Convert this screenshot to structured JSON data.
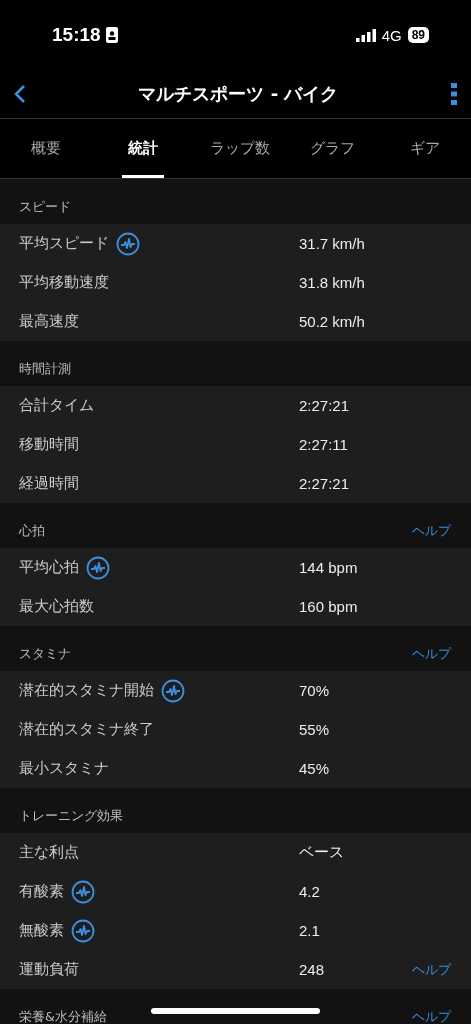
{
  "status_bar": {
    "time": "15:18",
    "network": "4G",
    "battery": "89"
  },
  "nav": {
    "title": "マルチスポーツ - バイク"
  },
  "tabs": [
    {
      "label": "概要",
      "selected": false
    },
    {
      "label": "統計",
      "selected": true
    },
    {
      "label": "ラップ数",
      "selected": false
    },
    {
      "label": "グラフ",
      "selected": false
    },
    {
      "label": "ギア",
      "selected": false
    }
  ],
  "sections": [
    {
      "title": "スピード",
      "rows": [
        {
          "label": "平均スピード",
          "chart": true,
          "value": "31.7 km/h"
        },
        {
          "label": "平均移動速度",
          "chart": false,
          "value": "31.8 km/h"
        },
        {
          "label": "最高速度",
          "chart": false,
          "value": "50.2 km/h"
        }
      ]
    },
    {
      "title": "時間計測",
      "rows": [
        {
          "label": "合計タイム",
          "chart": false,
          "value": "2:27:21"
        },
        {
          "label": "移動時間",
          "chart": false,
          "value": "2:27:11"
        },
        {
          "label": "経過時間",
          "chart": false,
          "value": "2:27:21"
        }
      ]
    },
    {
      "title": "心拍",
      "help": "ヘルプ",
      "rows": [
        {
          "label": "平均心拍",
          "chart": true,
          "value": "144 bpm"
        },
        {
          "label": "最大心拍数",
          "chart": false,
          "value": "160 bpm"
        }
      ]
    },
    {
      "title": "スタミナ",
      "help": "ヘルプ",
      "rows": [
        {
          "label": "潜在的スタミナ開始",
          "chart": true,
          "value": "70%"
        },
        {
          "label": "潜在的スタミナ終了",
          "chart": false,
          "value": "55%"
        },
        {
          "label": "最小スタミナ",
          "chart": false,
          "value": "45%"
        }
      ]
    },
    {
      "title": "トレーニング効果",
      "rows": [
        {
          "label": "主な利点",
          "chart": false,
          "value": "ベース"
        },
        {
          "label": "有酸素",
          "chart": true,
          "value": "4.2"
        },
        {
          "label": "無酸素",
          "chart": true,
          "value": "2.1"
        },
        {
          "label": "運動負荷",
          "chart": false,
          "value": "248",
          "help": "ヘルプ"
        }
      ]
    },
    {
      "title": "栄養&水分補給",
      "help": "ヘルプ"
    }
  ]
}
